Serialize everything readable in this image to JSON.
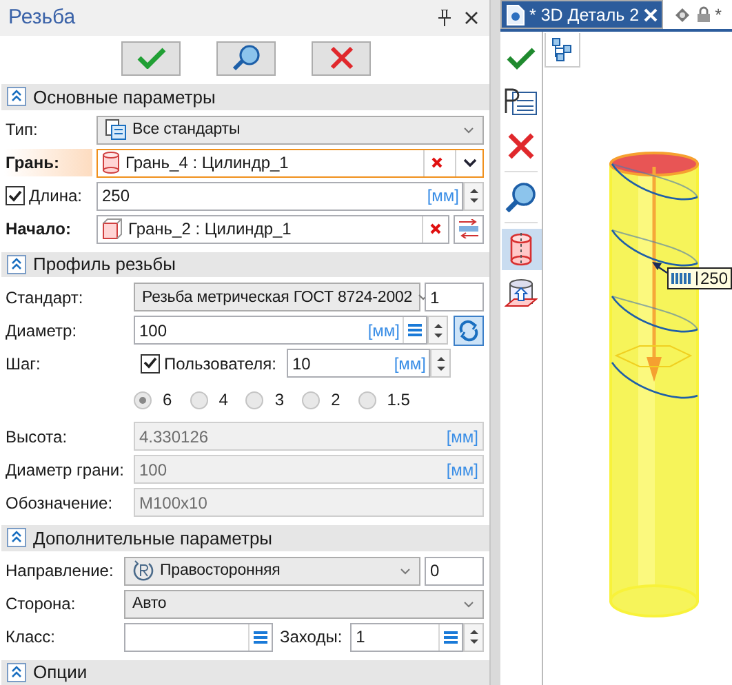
{
  "panel": {
    "title": "Резьба"
  },
  "sections": [
    {
      "title": "Основные параметры",
      "expanded": true,
      "rows": [
        {
          "kind": "select",
          "label": "Тип:",
          "value": "Все стандарты"
        },
        {
          "kind": "pick-list",
          "label": "Грань:",
          "value": "Грань_4 : Цилиндр_1",
          "active": true
        },
        {
          "kind": "check-spin",
          "label": "Длина:",
          "checked": true,
          "value": "250",
          "unit": "[мм]"
        },
        {
          "kind": "pick-swap",
          "label": "Начало:",
          "value": "Грань_2 : Цилиндр_1",
          "active": false
        }
      ]
    },
    {
      "title": "Профиль резьбы",
      "expanded": true,
      "rows": [
        {
          "kind": "select-extra",
          "label": "Стандарт:",
          "value": "Резьба метрическая ГОСТ 8724-2002",
          "extra": "1"
        },
        {
          "kind": "spin-list",
          "label": "Диаметр:",
          "value": "100",
          "unit": "[мм]"
        },
        {
          "kind": "step",
          "label": "Шаг:",
          "check_label": "Пользователя:",
          "checked": true,
          "value": "10",
          "unit": "[мм]"
        },
        {
          "kind": "radios",
          "options": [
            {
              "label": "6",
              "selected": true
            },
            {
              "label": "4",
              "selected": false
            },
            {
              "label": "3",
              "selected": false
            },
            {
              "label": "2",
              "selected": false
            },
            {
              "label": "1.5",
              "selected": false
            }
          ]
        },
        {
          "kind": "readonly",
          "label": "Высота:",
          "value": "4.330126",
          "unit": "[мм]"
        },
        {
          "kind": "readonly",
          "label": "Диаметр грани:",
          "value": "100",
          "unit": "[мм]"
        },
        {
          "kind": "readonly",
          "label": "Обозначение:",
          "value": "M100x10"
        }
      ]
    },
    {
      "title": "Дополнительные параметры",
      "expanded": true,
      "rows": [
        {
          "kind": "select-extra",
          "label": "Направление:",
          "value": "Правосторонняя",
          "extra": "0"
        },
        {
          "kind": "select",
          "label": "Сторона:",
          "value": "Авто"
        },
        {
          "kind": "pair",
          "label": "Класс:",
          "label2": "Заходы:",
          "value2": "1"
        }
      ]
    },
    {
      "title": "Опции",
      "expanded": true
    }
  ],
  "tabs": [
    {
      "label": "* 3D Деталь 2",
      "selected": true
    },
    {
      "label": "*",
      "selected": false
    }
  ],
  "viewport": {
    "dimension": "250"
  }
}
